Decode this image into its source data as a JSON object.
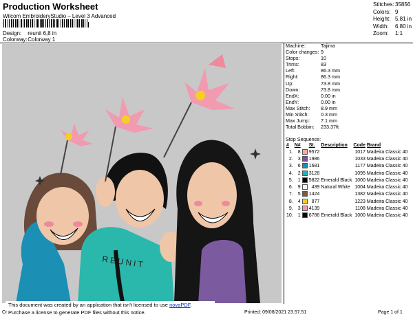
{
  "header": {
    "title": "Production Worksheet",
    "subtitle": "Wilcom EmbroideryStudio – Level 3 Advanced",
    "design_label": "Design:",
    "design_value": "reunit 6,8 in",
    "colorway_label": "Colorway:",
    "colorway_value": "Colorway 1"
  },
  "summary": [
    {
      "label": "Stitches:",
      "value": "35856"
    },
    {
      "label": "Colors:",
      "value": "9"
    },
    {
      "label": "Height:",
      "value": "5.81 in"
    },
    {
      "label": "Width:",
      "value": "6.80 in"
    },
    {
      "label": "Zoom:",
      "value": "1:1"
    }
  ],
  "machine_info": [
    {
      "label": "Machine:",
      "value": "Tajima"
    },
    {
      "label": "Color changes:",
      "value": "9"
    },
    {
      "label": "Stops:",
      "value": "10"
    },
    {
      "label": "Trims:",
      "value": "83"
    },
    {
      "label": "Left:",
      "value": "86.3 mm"
    },
    {
      "label": "Right:",
      "value": "86.3 mm"
    },
    {
      "label": "Up:",
      "value": "73.8 mm"
    },
    {
      "label": "Down:",
      "value": "73.8 mm"
    },
    {
      "label": "EndX:",
      "value": "0.00 in"
    },
    {
      "label": "EndY:",
      "value": "0.00 in"
    },
    {
      "label": "Max Stitch:",
      "value": "8.9 mm"
    },
    {
      "label": "Min Stitch:",
      "value": "0.3 mm"
    },
    {
      "label": "Max Jump:",
      "value": "7.1 mm"
    },
    {
      "label": "Total Bobbin:",
      "value": "233.37ft"
    }
  ],
  "stop_sequence": {
    "title": "Stop Sequence:",
    "headers": [
      "#",
      "N#",
      "St.",
      "Description",
      "Code",
      "Brand"
    ],
    "rows": [
      {
        "n": "1.",
        "needle": "8",
        "color": "#f2a8a0",
        "st": "9572",
        "desc": "",
        "code": "1017",
        "brand": "Madeira Classic 40"
      },
      {
        "n": "2.",
        "needle": "3",
        "color": "#7c4fa0",
        "st": "1986",
        "desc": "",
        "code": "1033",
        "brand": "Madeira Classic 40"
      },
      {
        "n": "3.",
        "needle": "6",
        "color": "#1a8fb0",
        "st": "1681",
        "desc": "",
        "code": "1177",
        "brand": "Madeira Classic 40"
      },
      {
        "n": "4.",
        "needle": "2",
        "color": "#1fb3b8",
        "st": "3128",
        "desc": "",
        "code": "1095",
        "brand": "Madeira Classic 40"
      },
      {
        "n": "5.",
        "needle": "1",
        "color": "#000000",
        "st": "5822",
        "desc": "Emerald Black",
        "code": "1000",
        "brand": "Madeira Classic 40"
      },
      {
        "n": "6.",
        "needle": "9",
        "color": "#f4f4f0",
        "st": "439",
        "desc": "Natural White",
        "code": "1004",
        "brand": "Madeira Classic 40"
      },
      {
        "n": "7.",
        "needle": "5",
        "color": "#7a5a48",
        "st": "1424",
        "desc": "",
        "code": "1382",
        "brand": "Madeira Classic 40"
      },
      {
        "n": "8.",
        "needle": "4",
        "color": "#f5d020",
        "st": "877",
        "desc": "",
        "code": "1223",
        "brand": "Madeira Classic 40"
      },
      {
        "n": "9.",
        "needle": "3",
        "color": "#f29ab0",
        "st": "4139",
        "desc": "",
        "code": "1108",
        "brand": "Madeira Classic 40"
      },
      {
        "n": "10.",
        "needle": "1",
        "color": "#000000",
        "st": "6786",
        "desc": "Emerald Black",
        "code": "1000",
        "brand": "Madeira Classic 40"
      }
    ]
  },
  "artwork_text": "REUNIT",
  "notice": {
    "line1_prefix": "This document was created by an application that isn't licensed to use ",
    "line1_link": "novaPDF",
    "line1_suffix": ".",
    "line2": "Purchase a license to generate PDF files without this notice."
  },
  "footer": {
    "cr": "Cr",
    "printed": "Printed: 09/08/2021 23.57.51",
    "page": "Page 1 of 1"
  }
}
